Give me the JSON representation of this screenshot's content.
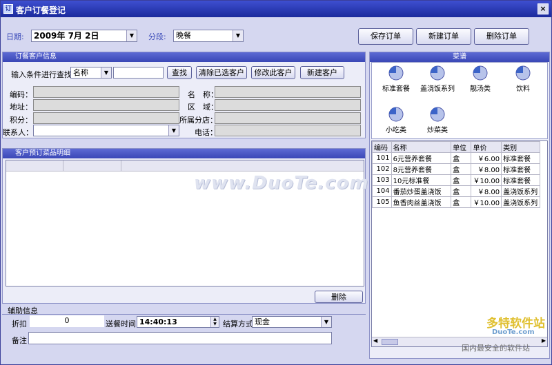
{
  "window": {
    "title": "客户订餐登记",
    "close": "×"
  },
  "toolbar": {
    "date_label": "日期:",
    "date_value": "2009年 7月 2日",
    "shift_label": "分段:",
    "shift_value": "晚餐",
    "save": "保存订单",
    "new_order": "新建订单",
    "delete_order": "删除订单"
  },
  "customer": {
    "title": "订餐客户信息",
    "search_label": "输入条件进行查找",
    "search_field": "名称",
    "search_value": "",
    "btn_find": "查找",
    "btn_clear": "清除已选客户",
    "btn_modify": "修改此客户",
    "btn_new": "新建客户",
    "code_label": "编码：",
    "name_label": "名　称：",
    "addr_label": "地址：",
    "area_label": "区　域：",
    "points_label": "积分：",
    "branch_label": "所属分店：",
    "contact_label": "联系人：",
    "phone_label": "电话："
  },
  "details": {
    "title": "客户预订菜品明细",
    "delete": "删除"
  },
  "aux": {
    "title": "辅助信息",
    "discount_label": "折扣",
    "discount_value": "0",
    "time_label": "送餐时间",
    "time_value": "14:40:13",
    "payment_label": "结算方式",
    "payment_value": "现金",
    "note_label": "备注"
  },
  "menu": {
    "title": "菜谱",
    "categories": [
      "标准套餐",
      "盖浇饭系列",
      "靓汤类",
      "饮料",
      "小吃类",
      "炒菜类"
    ],
    "headers": [
      "编码",
      "名称",
      "单位",
      "单价",
      "类别"
    ],
    "rows": [
      [
        "101",
        "6元营养套餐",
        "盒",
        "￥6.00",
        "标准套餐"
      ],
      [
        "102",
        "8元营养套餐",
        "盒",
        "￥8.00",
        "标准套餐"
      ],
      [
        "103",
        "10元标准餐",
        "盒",
        "￥10.00",
        "标准套餐"
      ],
      [
        "104",
        "番茄炒蛋盖浇饭",
        "盒",
        "￥8.00",
        "盖浇饭系列"
      ],
      [
        "105",
        "鱼香肉丝盖浇饭",
        "盒",
        "￥10.00",
        "盖浇饭系列"
      ]
    ]
  },
  "watermarks": {
    "center": "www.DuoTe.com",
    "brand": "多特软件站",
    "brand_url": "DuoTe.com",
    "slogan": "国内最安全的软件站"
  }
}
